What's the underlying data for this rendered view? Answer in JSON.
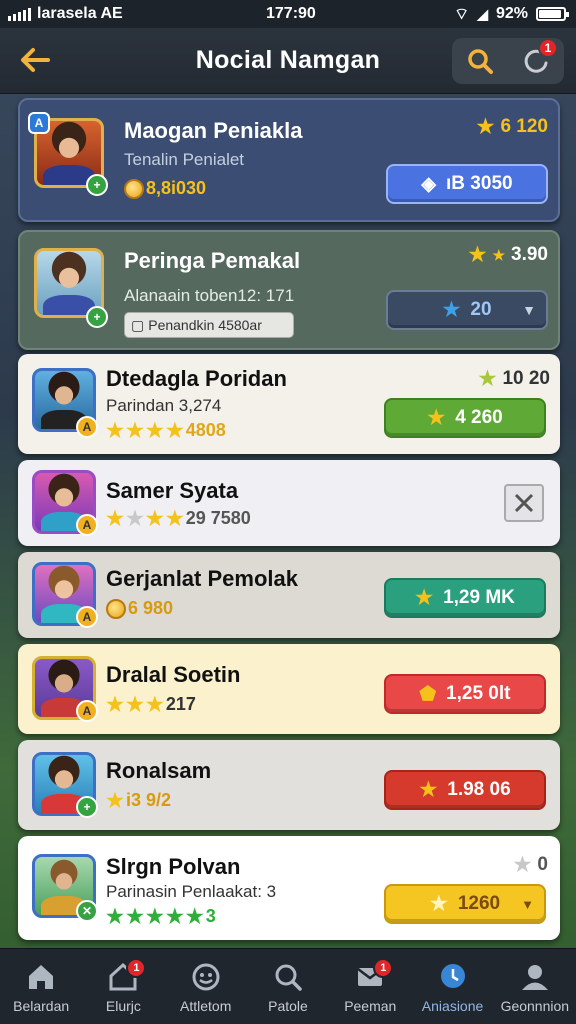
{
  "status_bar": {
    "carrier": "larasela AE",
    "time": "177:90",
    "battery": "92%"
  },
  "header": {
    "title": "Nocial Namgan",
    "notification_count": "1"
  },
  "players": [
    {
      "name": "Maogan Peniakla",
      "subtitle": "Tenalin Penialet",
      "coins": "8,8i030",
      "corner_value": "6 120",
      "action_label": "ıB 3050",
      "colors": {
        "bg": "#3b4d73",
        "name": "#ffffff",
        "button": "#4a72e0"
      }
    },
    {
      "name": "Peringa Pemakal",
      "subtitle": "Alanaain toben12: 171",
      "tag": "Penandkin 4580ar",
      "corner_value": "3.90",
      "action_label": "20",
      "colors": {
        "bg": "#56695e",
        "name": "#ffffff",
        "button": "#3a4a62"
      }
    },
    {
      "name": "Dtedagla Poridan",
      "subtitle": "Parindan 3,274",
      "rating_text": "4808",
      "corner_value": "10 20",
      "action_label": "4 260",
      "colors": {
        "bg": "#f3f1ea",
        "name": "#111111",
        "button": "#5faa36"
      }
    },
    {
      "name": "Samer Syata",
      "rating_text": "29 7580",
      "colors": {
        "bg": "#f0eff4",
        "name": "#111111"
      }
    },
    {
      "name": "Gerjanlat Pemolak",
      "coins": "6 980",
      "action_label": "1,29 MK",
      "colors": {
        "bg": "#dcdad3",
        "name": "#111111",
        "button": "#2aa07e"
      }
    },
    {
      "name": "Dralal Soetin",
      "rating_text": "217",
      "action_label": "1,25 0lt",
      "colors": {
        "bg": "#fbf1cd",
        "name": "#111111",
        "button": "#e84848"
      }
    },
    {
      "name": "Ronalsam",
      "rating_text": "i3 9/2",
      "action_label": "1.98 06",
      "colors": {
        "bg": "#e2e0dc",
        "name": "#111111",
        "button": "#d63a2c"
      }
    },
    {
      "name": "Slrgn Polvan",
      "subtitle": "Parinasin Penlaakat: 3",
      "rating_text": "3",
      "corner_value": "0",
      "action_label": "1260",
      "colors": {
        "bg": "#ffffff",
        "name": "#111111",
        "button": "#f5c521"
      }
    }
  ],
  "bottom_nav": [
    {
      "label": "Belardan",
      "icon": "home-icon"
    },
    {
      "label": "Elurjc",
      "icon": "house-badge-icon",
      "badge": "1"
    },
    {
      "label": "Attletom",
      "icon": "smiley-icon"
    },
    {
      "label": "Patole",
      "icon": "search-icon"
    },
    {
      "label": "Peeman",
      "icon": "mail-icon",
      "badge": "1"
    },
    {
      "label": "Aniasione",
      "icon": "location-icon"
    },
    {
      "label": "Geonnnion",
      "icon": "profile-icon"
    }
  ]
}
